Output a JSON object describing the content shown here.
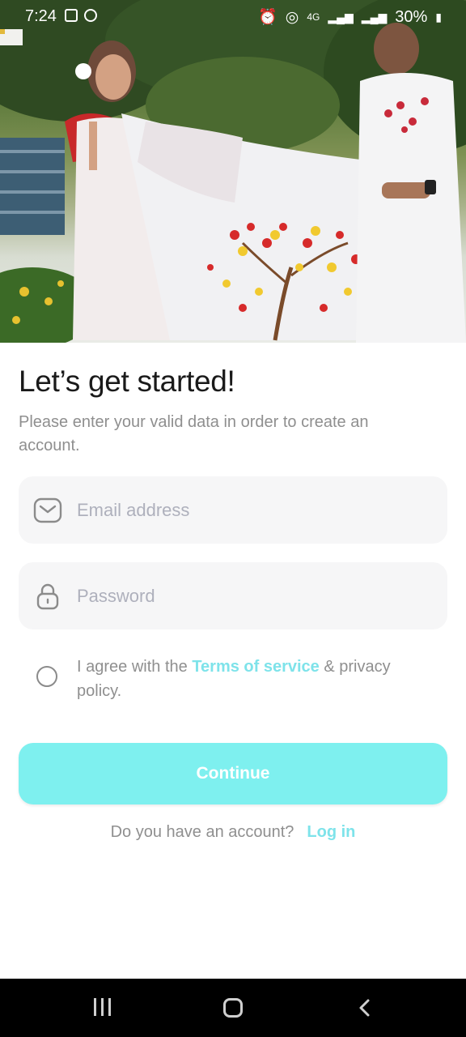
{
  "status_bar": {
    "time": "7:24",
    "battery": "30%",
    "network": "4G"
  },
  "hero": {
    "image": "couple-in-white-saree-and-panjabi-photo"
  },
  "signup": {
    "title": "Let’s get started!",
    "subtitle": "Please enter your valid data in order to create an account.",
    "email": {
      "placeholder": "Email address",
      "value": "",
      "icon": "mail-icon"
    },
    "password": {
      "placeholder": "Password",
      "value": "",
      "icon": "lock-icon"
    },
    "agree": {
      "prefix": "I agree with the ",
      "terms_link": "Terms of service",
      "suffix": " & privacy policy.",
      "checked": false
    },
    "continue_label": "Continue",
    "login_prompt": "Do you have an account?",
    "login_link": "Log in"
  },
  "colors": {
    "accent": "#7ee3ea",
    "button": "#7ef0ef",
    "field_bg": "#f6f6f7",
    "muted_text": "#8f8f8f"
  },
  "nav_bar": {
    "icons": [
      "recent-apps-icon",
      "home-icon",
      "back-icon"
    ]
  }
}
